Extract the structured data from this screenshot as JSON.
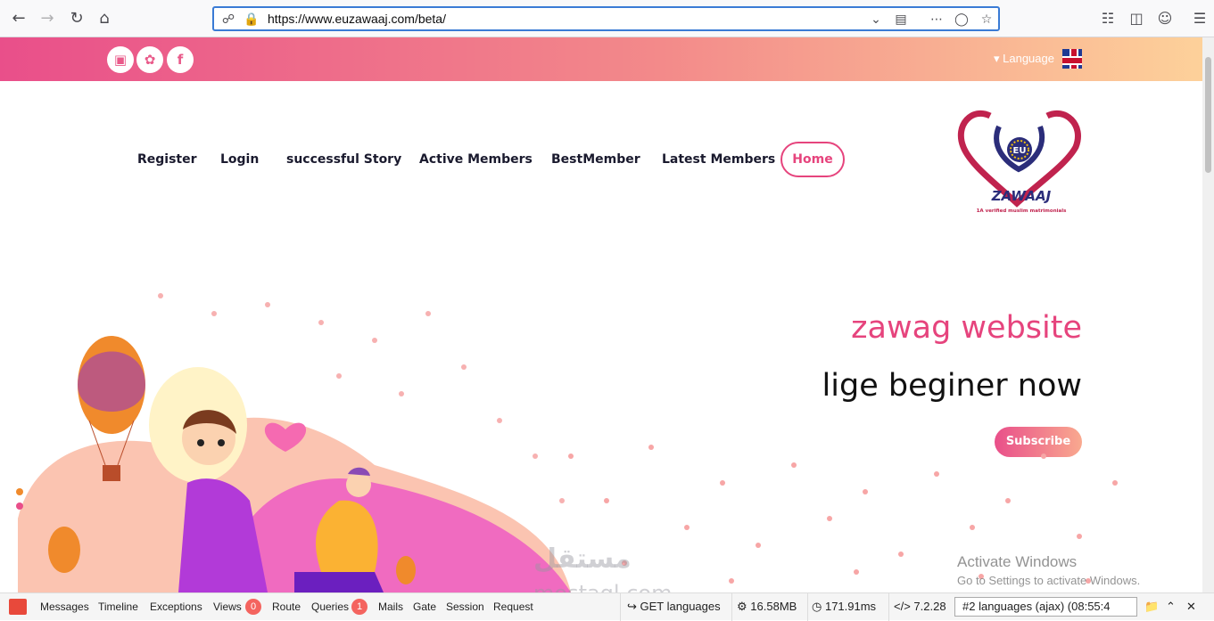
{
  "browser": {
    "url": "https://www.euzawaaj.com/beta/",
    "back_icon": "back-arrow-icon",
    "forward_icon": "forward-arrow-icon"
  },
  "topbar": {
    "language_label": "Language"
  },
  "nav": {
    "items": [
      "Register",
      "Login",
      "successful Story",
      "Active Members",
      "BestMember",
      "Latest Members"
    ],
    "home": "Home"
  },
  "logo": {
    "name": "ZAWAAJ",
    "badge": "EU",
    "tagline": "1A verified muslim matrimonials"
  },
  "hero": {
    "title": "zawag website",
    "subtitle": "lige beginer now",
    "cta": "Subscribe"
  },
  "watermark": {
    "arabic": "مستقل",
    "latin": "mostaql.com"
  },
  "windows": {
    "activate_title": "Activate Windows",
    "activate_sub": "Go to Settings to activate Windows."
  },
  "debugbar": {
    "tabs": [
      "Messages",
      "Timeline",
      "Exceptions",
      "Views",
      "Route",
      "Queries",
      "Mails",
      "Gate",
      "Session",
      "Request"
    ],
    "views_count": "0",
    "queries_count": "1",
    "route": "GET languages",
    "memory": "16.58MB",
    "time": "171.91ms",
    "php": "7.2.28",
    "request_select": "#2 languages (ajax) (08:55:4"
  },
  "colors": {
    "accent": "#e6447d",
    "band_start": "#e94f8a",
    "band_end": "#fdd19a"
  }
}
